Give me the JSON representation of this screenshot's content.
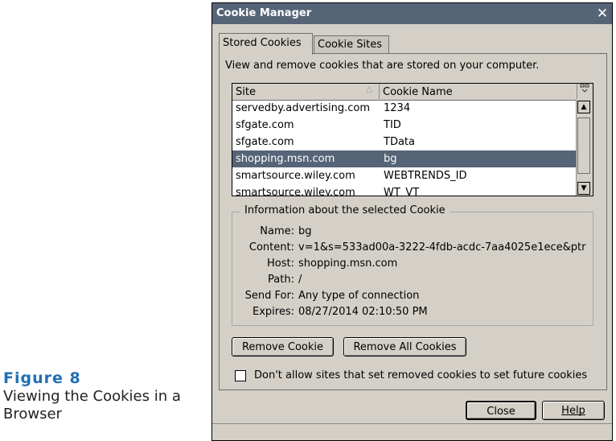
{
  "caption": {
    "figure": "Figure 8",
    "text": "Viewing the Cookies in a Browser"
  },
  "window": {
    "title": "Cookie Manager",
    "close_glyph": "✕"
  },
  "tabs": [
    {
      "label": "Stored Cookies",
      "active": true
    },
    {
      "label": "Cookie Sites",
      "active": false
    }
  ],
  "description": "View and remove cookies that are stored on your computer.",
  "list": {
    "columns": [
      "Site",
      "Cookie Name"
    ],
    "sort_indicator": "△",
    "column_picker_icon": "column-picker-icon",
    "rows": [
      {
        "site": "servedby.advertising.com",
        "name": "1234",
        "selected": false
      },
      {
        "site": "sfgate.com",
        "name": "TID",
        "selected": false
      },
      {
        "site": "sfgate.com",
        "name": "TData",
        "selected": false
      },
      {
        "site": "shopping.msn.com",
        "name": "bg",
        "selected": true
      },
      {
        "site": "smartsource.wiley.com",
        "name": "WEBTRENDS_ID",
        "selected": false
      },
      {
        "site": "smartsource.wiley.com",
        "name": "WT_VT",
        "selected": false
      }
    ]
  },
  "info": {
    "legend": "Information about the selected Cookie",
    "fields": [
      {
        "label": "Name:",
        "value": "bg"
      },
      {
        "label": "Content:",
        "value": "v=1&s=533ad00a-3222-4fdb-acdc-7aa4025e1ece&ptr"
      },
      {
        "label": "Host:",
        "value": "shopping.msn.com"
      },
      {
        "label": "Path:",
        "value": "/"
      },
      {
        "label": "Send For:",
        "value": "Any type of connection"
      },
      {
        "label": "Expires:",
        "value": "08/27/2014 02:10:50 PM"
      }
    ]
  },
  "buttons": {
    "remove_cookie": "Remove Cookie",
    "remove_all": "Remove All Cookies",
    "close": "Close",
    "help": "Help"
  },
  "checkbox": {
    "label": "Don't allow sites that set removed cookies to set future cookies",
    "checked": false
  },
  "colors": {
    "titlebar": "#566478",
    "selection": "#566478",
    "dialog_bg": "#d4d0c8",
    "caption_accent": "#1f6fb5"
  }
}
